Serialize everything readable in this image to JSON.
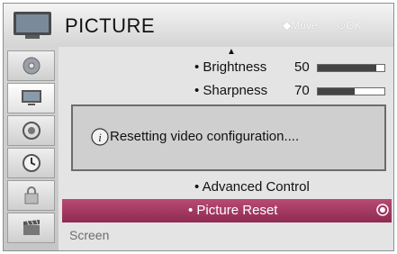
{
  "header": {
    "title": "PICTURE",
    "move_hint": "Move",
    "ok_hint": "OK"
  },
  "menu": {
    "brightness": {
      "label": "• Brightness",
      "value": "50",
      "level": 0.88
    },
    "sharpness": {
      "label": "• Sharpness",
      "value": "70",
      "level": 0.55
    },
    "advanced": {
      "label": "• Advanced Control"
    },
    "reset": {
      "label": "• Picture Reset"
    },
    "screen": {
      "label": "Screen"
    }
  },
  "dialog": {
    "message": "Resetting video configuration...."
  },
  "colors": {
    "selection": "#9f3a5f",
    "bar_fill": "#444444",
    "accent_hint": "#ffffff"
  },
  "sidebar": {
    "items": [
      {
        "icon": "disc-icon"
      },
      {
        "icon": "monitor-icon"
      },
      {
        "icon": "speaker-icon"
      },
      {
        "icon": "clock-icon"
      },
      {
        "icon": "lock-icon"
      },
      {
        "icon": "clapperboard-icon"
      }
    ]
  }
}
